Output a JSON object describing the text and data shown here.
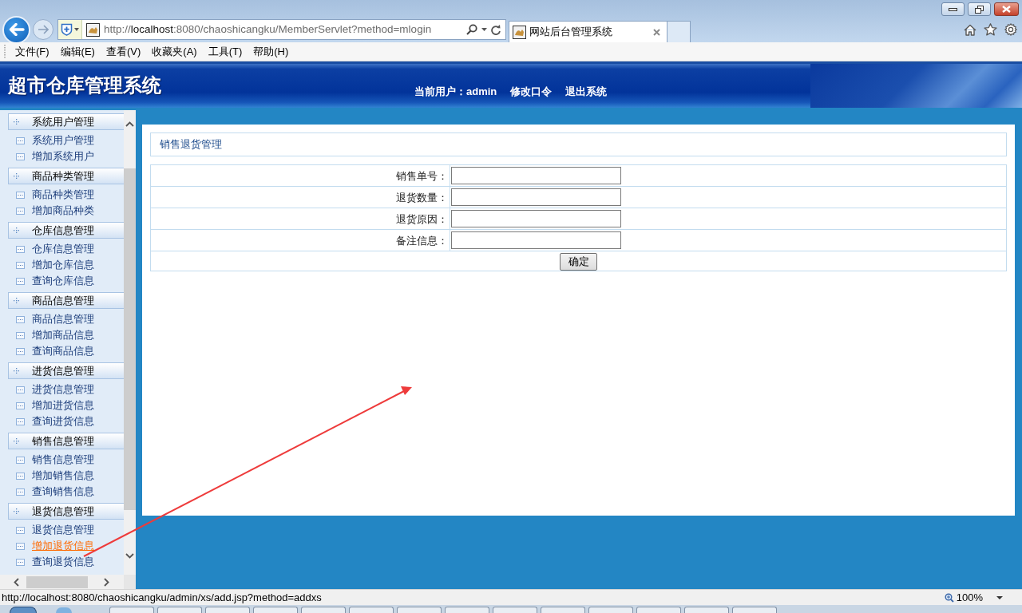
{
  "browser": {
    "address": {
      "scheme": "http://",
      "host": "localhost",
      "path": ":8080/chaoshicangku/MemberServlet?method=mlogin"
    },
    "tabs": [
      {
        "title": "网站后台管理系统",
        "selected": true
      }
    ],
    "menu": [
      "文件(F)",
      "编辑(E)",
      "查看(V)",
      "收藏夹(A)",
      "工具(T)",
      "帮助(H)"
    ],
    "status_url": "http://localhost:8080/chaoshicangku/admin/xs/add.jsp?method=addxs",
    "zoom": "100%"
  },
  "header": {
    "title": "超市仓库管理系统",
    "current_user": "当前用户：admin",
    "links": [
      "修改口令",
      "退出系统"
    ]
  },
  "sidebar": {
    "groups": [
      {
        "title": "系统用户管理",
        "items": [
          {
            "label": "系统用户管理",
            "selected": false
          },
          {
            "label": "增加系统用户",
            "selected": false
          }
        ]
      },
      {
        "title": "商品种类管理",
        "items": [
          {
            "label": "商品种类管理",
            "selected": false
          },
          {
            "label": "增加商品种类",
            "selected": false
          }
        ]
      },
      {
        "title": "仓库信息管理",
        "items": [
          {
            "label": "仓库信息管理",
            "selected": false
          },
          {
            "label": "增加仓库信息",
            "selected": false
          },
          {
            "label": "查询仓库信息",
            "selected": false
          }
        ]
      },
      {
        "title": "商品信息管理",
        "items": [
          {
            "label": "商品信息管理",
            "selected": false
          },
          {
            "label": "增加商品信息",
            "selected": false
          },
          {
            "label": "查询商品信息",
            "selected": false
          }
        ]
      },
      {
        "title": "进货信息管理",
        "items": [
          {
            "label": "进货信息管理",
            "selected": false
          },
          {
            "label": "增加进货信息",
            "selected": false
          },
          {
            "label": "查询进货信息",
            "selected": false
          }
        ]
      },
      {
        "title": "销售信息管理",
        "items": [
          {
            "label": "销售信息管理",
            "selected": false
          },
          {
            "label": "增加销售信息",
            "selected": false
          },
          {
            "label": "查询销售信息",
            "selected": false
          }
        ]
      },
      {
        "title": "退货信息管理",
        "items": [
          {
            "label": "退货信息管理",
            "selected": false
          },
          {
            "label": "增加退货信息",
            "selected": true
          },
          {
            "label": "查询退货信息",
            "selected": false
          }
        ]
      }
    ]
  },
  "content": {
    "title": "销售退货管理",
    "fields": [
      {
        "label": "销售单号："
      },
      {
        "label": "退货数量："
      },
      {
        "label": "退货原因："
      },
      {
        "label": "备注信息："
      }
    ],
    "submit": "确定"
  }
}
